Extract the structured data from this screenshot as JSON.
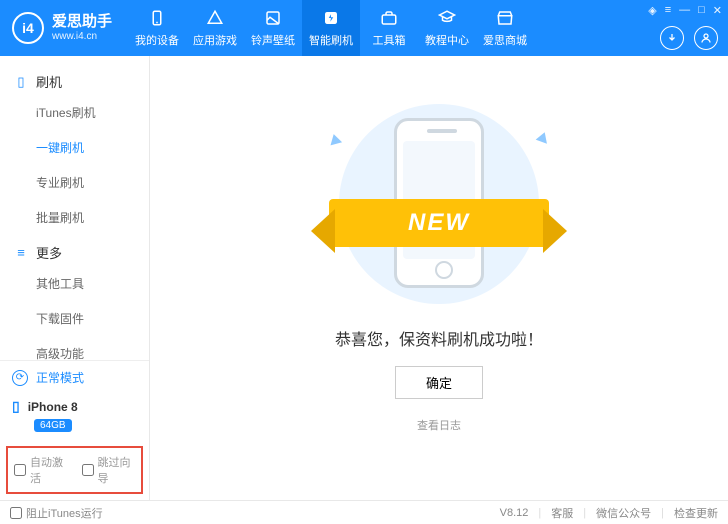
{
  "brand": {
    "name": "爱思助手",
    "url": "www.i4.cn",
    "logo_text": "i4"
  },
  "nav": [
    {
      "label": "我的设备"
    },
    {
      "label": "应用游戏"
    },
    {
      "label": "铃声壁纸"
    },
    {
      "label": "智能刷机"
    },
    {
      "label": "工具箱"
    },
    {
      "label": "教程中心"
    },
    {
      "label": "爱思商城"
    }
  ],
  "sidebar": {
    "section1": "刷机",
    "items1": [
      "iTunes刷机",
      "一键刷机",
      "专业刷机",
      "批量刷机"
    ],
    "section2": "更多",
    "items2": [
      "其他工具",
      "下载固件",
      "高级功能"
    ],
    "status": "正常模式",
    "device": "iPhone 8",
    "storage": "64GB",
    "check1": "自动激活",
    "check2": "跳过向导"
  },
  "main": {
    "ribbon": "NEW",
    "success": "恭喜您，保资料刷机成功啦！",
    "ok": "确定",
    "log": "查看日志"
  },
  "footer": {
    "block_itunes": "阻止iTunes运行",
    "version": "V8.12",
    "support": "客服",
    "wechat": "微信公众号",
    "update": "检查更新"
  }
}
